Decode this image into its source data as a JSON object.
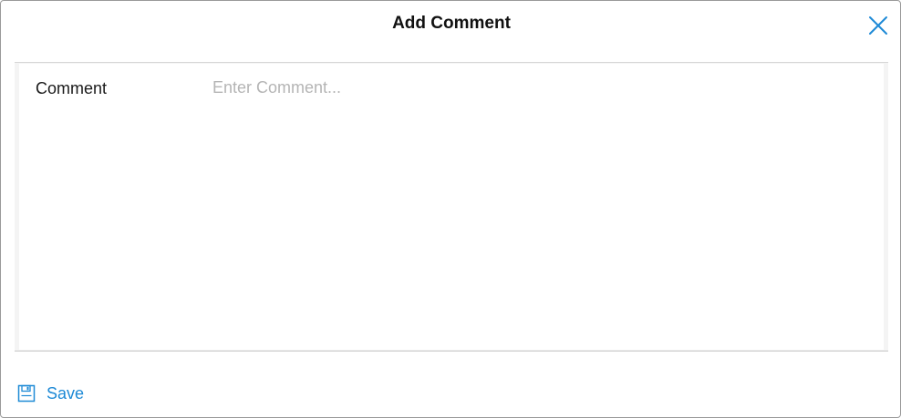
{
  "dialog": {
    "title": "Add Comment",
    "close_icon": "close-icon"
  },
  "form": {
    "comment_label": "Comment",
    "comment_placeholder": "Enter Comment...",
    "comment_value": ""
  },
  "footer": {
    "save_label": "Save",
    "save_icon": "floppy-disk-icon"
  },
  "colors": {
    "accent": "#1e8ad6",
    "title_text": "#111111",
    "placeholder": "#b5b5b5",
    "panel_bg": "#f4f4f4"
  }
}
